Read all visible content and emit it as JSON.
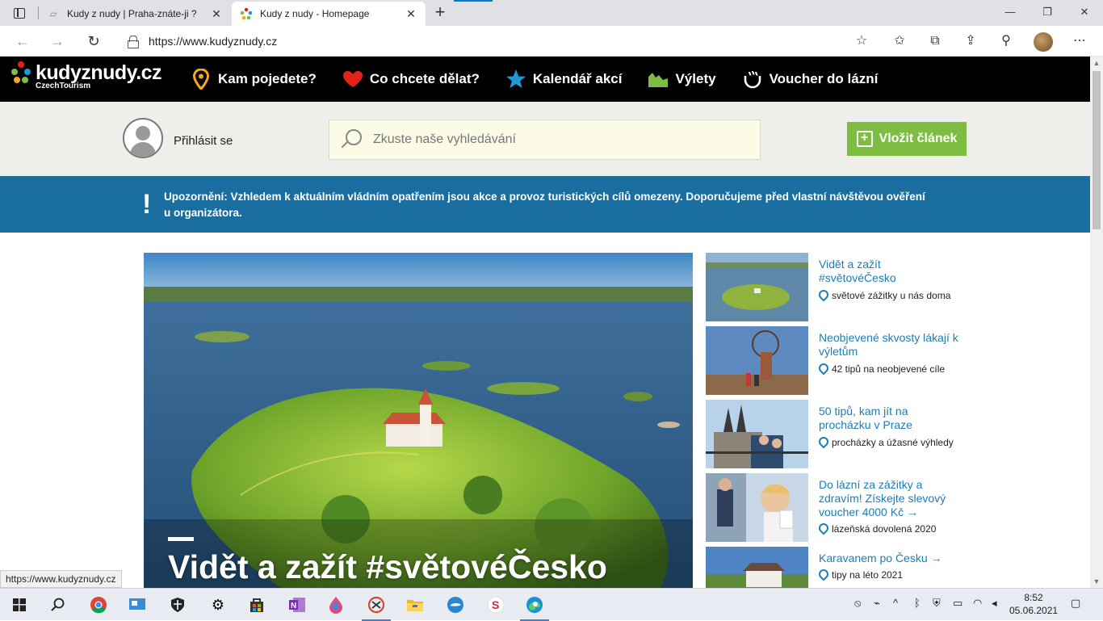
{
  "browser": {
    "tabs": [
      {
        "title": "Kudy z nudy | Praha-znáte-ji ?",
        "close": "✕"
      },
      {
        "title": "Kudy z nudy - Homepage",
        "close": "✕"
      }
    ],
    "new_tab": "+",
    "url": "https://www.kudyznudy.cz",
    "window_controls": {
      "minimize": "—",
      "maximize": "❐",
      "close": "✕"
    },
    "nav": {
      "back": "←",
      "forward": "→",
      "refresh": "↻"
    },
    "status_url": "https://www.kudyznudy.cz"
  },
  "site": {
    "logo": {
      "name": "kudyznudy.cz",
      "sub": "CzechTourism"
    },
    "nav": [
      {
        "label": "Kam pojedete?",
        "icon": "map-pin-icon",
        "color": "#f5a623"
      },
      {
        "label": "Co chcete dělat?",
        "icon": "heart-icon",
        "color": "#e2231a"
      },
      {
        "label": "Kalendář akcí",
        "icon": "star-icon",
        "color": "#1c9ad6"
      },
      {
        "label": "Výlety",
        "icon": "hills-icon",
        "color": "#7cbd42"
      },
      {
        "label": "Voucher do lázní",
        "icon": "spa-icon",
        "color": "#ffffff"
      }
    ],
    "login_label": "Přihlásit se",
    "search_placeholder": "Zkuste naše vyhledávání",
    "add_article_label": "Vložit článek",
    "notice": {
      "bang": "!",
      "lead": "Upozornění:",
      "text": "Vzhledem k aktuálním vládním opatřením jsou akce a provoz turistických cílů omezeny. Doporučujeme před vlastní návštěvou ověření u organizátora."
    },
    "hero_title": "Vidět a zažít #světovéČesko",
    "side_items": [
      {
        "title": "Vidět a zažít #světovéČesko",
        "sub": "světové zážitky u nás doma"
      },
      {
        "title": "Neobjevené skvosty lákají k výletům",
        "sub": "42 tipů na neobjevené cíle"
      },
      {
        "title": "50 tipů, kam jít na procházku v Praze",
        "sub": "procházky a úžasné výhledy"
      },
      {
        "title": "Do lázní za zážitky a zdravím! Získejte slevový voucher 4000 Kč →",
        "sub": "lázeňská dovolená 2020"
      },
      {
        "title": "Karavanem po Česku →",
        "sub": "tipy na léto 2021"
      }
    ]
  },
  "taskbar": {
    "time": "8:52",
    "date": "05.06.2021"
  }
}
